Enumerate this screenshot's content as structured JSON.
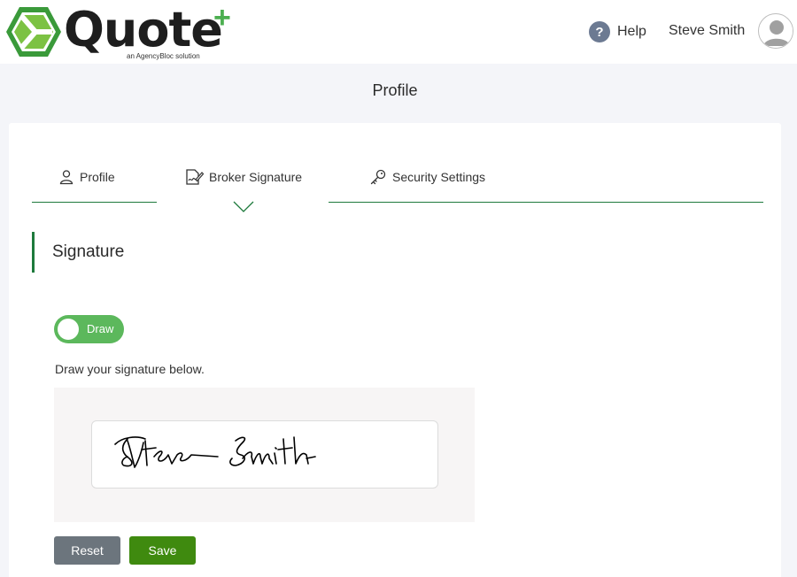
{
  "app": {
    "logo_text": "Quote",
    "logo_plus": "+",
    "logo_tagline": "an AgencyBloc solution",
    "help_label": "Help",
    "help_glyph": "?",
    "user_name": "Steve Smith"
  },
  "page": {
    "title": "Profile"
  },
  "tabs": [
    {
      "label": "Profile",
      "icon": "person-icon"
    },
    {
      "label": "Broker Signature",
      "icon": "signature-icon",
      "active": true
    },
    {
      "label": "Security Settings",
      "icon": "key-icon"
    }
  ],
  "section": {
    "title": "Signature"
  },
  "signature": {
    "mode_label": "Draw",
    "mode_enabled": true,
    "instruction": "Draw your signature below.",
    "drawn_signature": "Steve Smith"
  },
  "buttons": {
    "reset_label": "Reset",
    "save_label": "Save"
  },
  "colors": {
    "brand_green": "#1e7a3c",
    "toggle_green": "#5cb85c",
    "save_green": "#3f8a0f",
    "reset_gray": "#6c757d",
    "help_blue_gray": "#6c7a92"
  }
}
